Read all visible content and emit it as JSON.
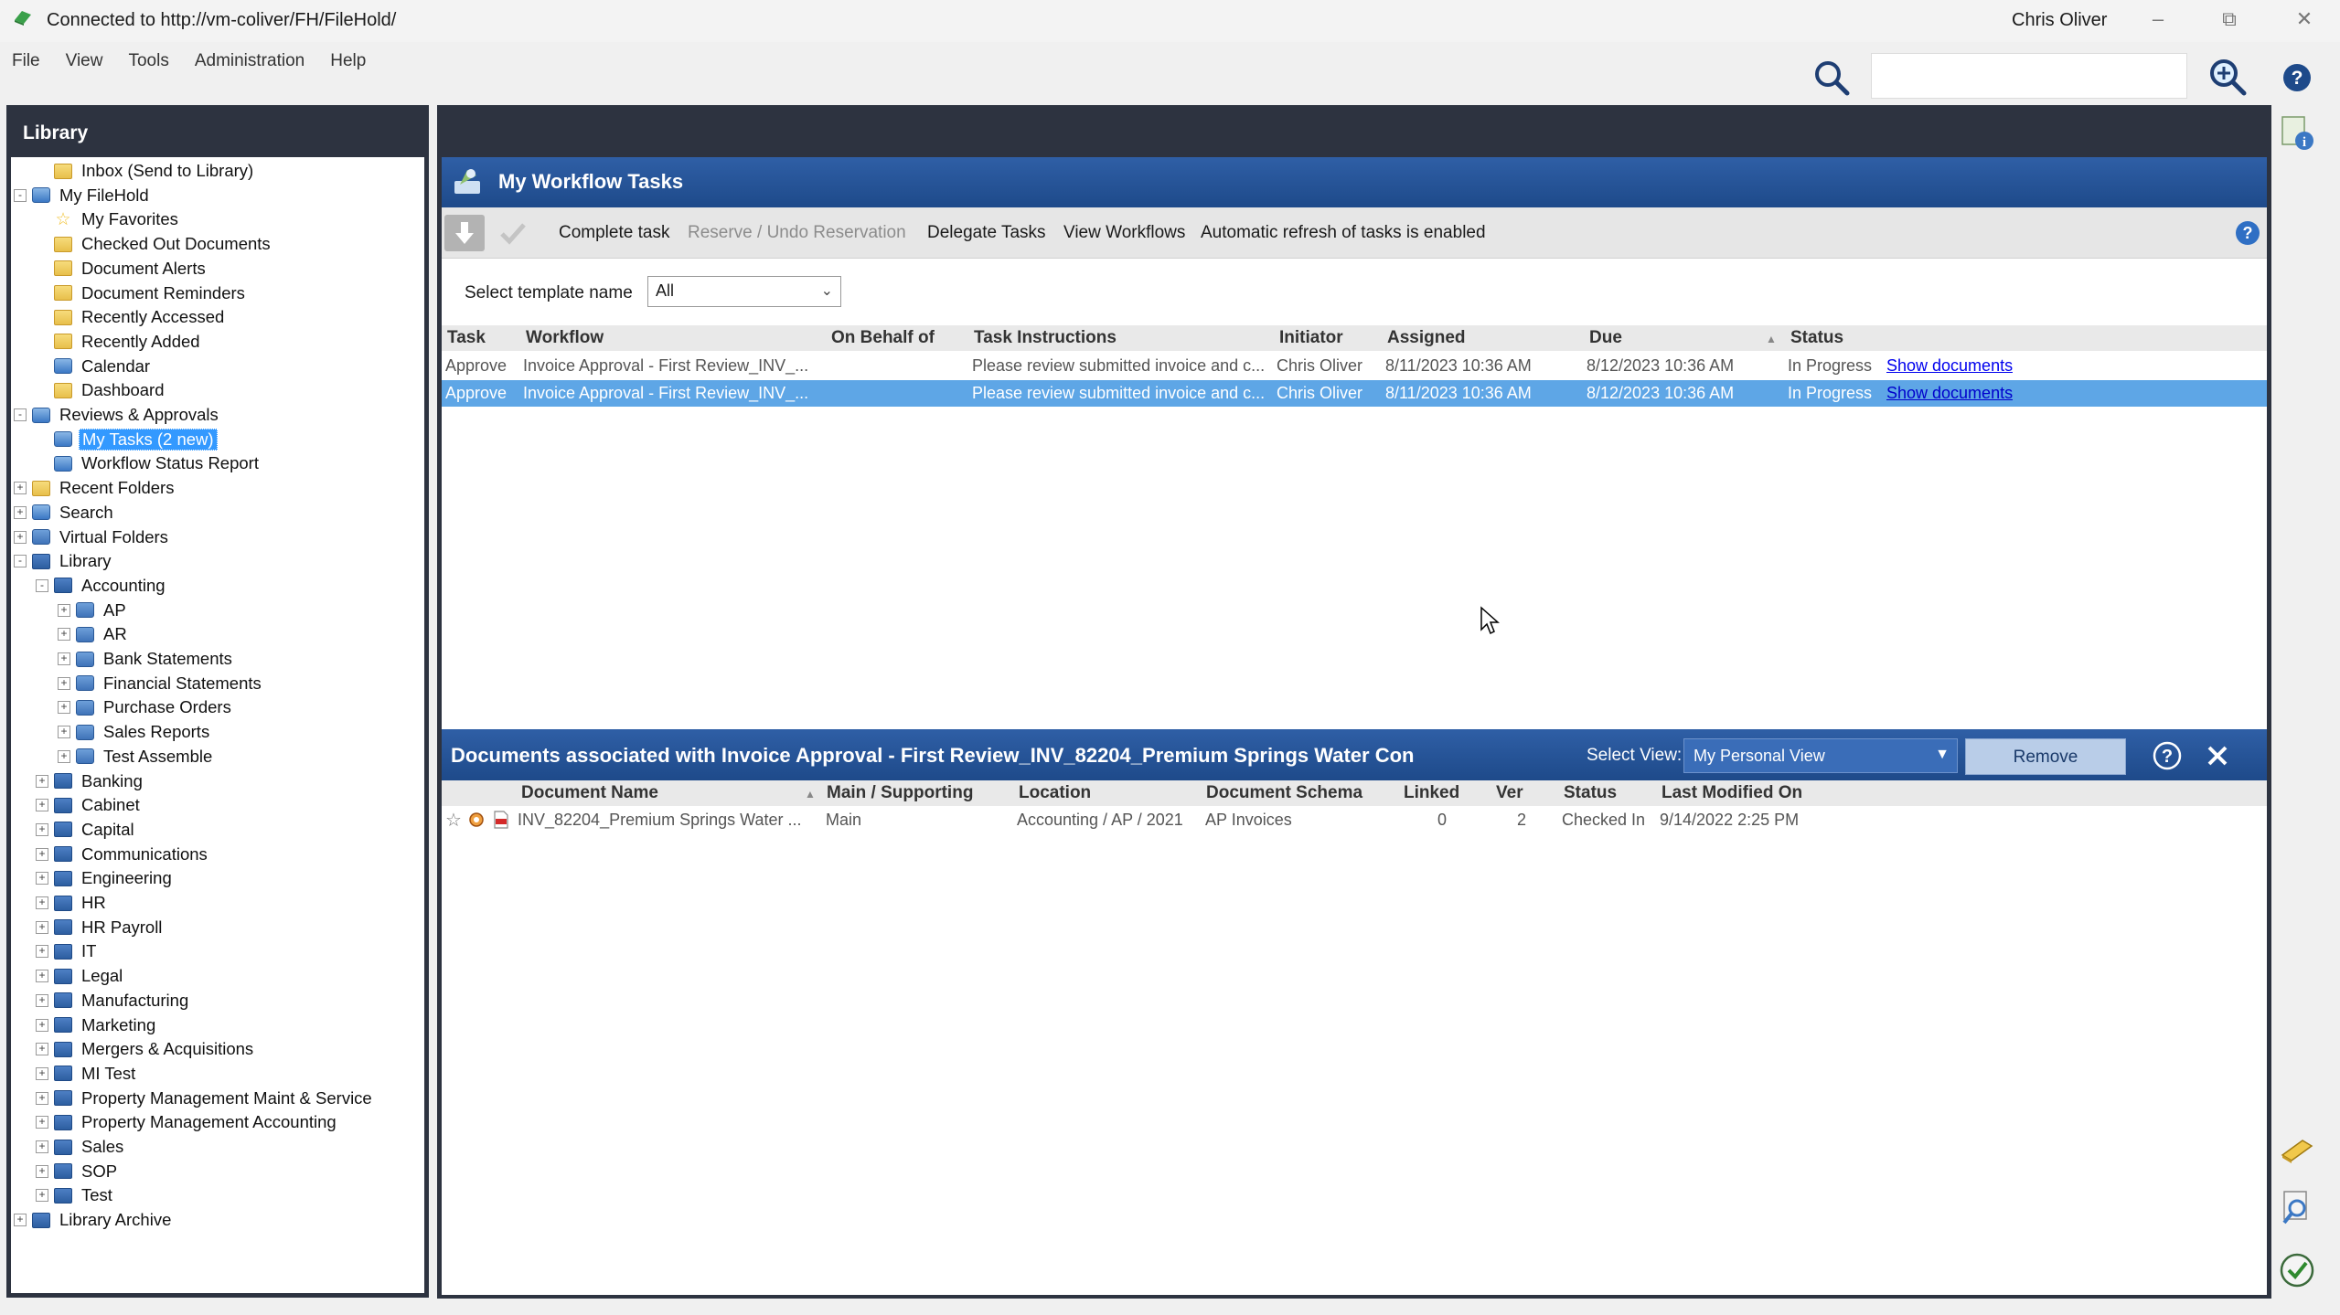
{
  "window": {
    "title": "Connected to http://vm-coliver/FH/FileHold/",
    "user": "Chris Oliver"
  },
  "menu": [
    "File",
    "View",
    "Tools",
    "Administration",
    "Help"
  ],
  "search": {
    "value": ""
  },
  "sidebar": {
    "title": "Library",
    "items": [
      {
        "label": "Inbox (Send to Library)",
        "level": 1,
        "exp": "",
        "icon": "folder"
      },
      {
        "label": "My FileHold",
        "level": 0,
        "exp": "-",
        "icon": "special"
      },
      {
        "label": "My Favorites",
        "level": 1,
        "exp": "",
        "icon": "star"
      },
      {
        "label": "Checked Out Documents",
        "level": 1,
        "exp": "",
        "icon": "folder"
      },
      {
        "label": "Document Alerts",
        "level": 1,
        "exp": "",
        "icon": "folder"
      },
      {
        "label": "Document Reminders",
        "level": 1,
        "exp": "",
        "icon": "folder"
      },
      {
        "label": "Recently Accessed",
        "level": 1,
        "exp": "",
        "icon": "folder"
      },
      {
        "label": "Recently Added",
        "level": 1,
        "exp": "",
        "icon": "folder"
      },
      {
        "label": "Calendar",
        "level": 1,
        "exp": "",
        "icon": "special"
      },
      {
        "label": "Dashboard",
        "level": 1,
        "exp": "",
        "icon": "folder"
      },
      {
        "label": "Reviews & Approvals",
        "level": 0,
        "exp": "-",
        "icon": "special"
      },
      {
        "label": "My Tasks (2 new)",
        "level": 1,
        "exp": "",
        "icon": "special",
        "selected": true
      },
      {
        "label": "Workflow Status Report",
        "level": 1,
        "exp": "",
        "icon": "special"
      },
      {
        "label": "Recent Folders",
        "level": 0,
        "exp": "+",
        "icon": "folder"
      },
      {
        "label": "Search",
        "level": 0,
        "exp": "+",
        "icon": "special"
      },
      {
        "label": "Virtual Folders",
        "level": 0,
        "exp": "+",
        "icon": "drawer"
      },
      {
        "label": "Library",
        "level": 0,
        "exp": "-",
        "icon": "cabinet"
      },
      {
        "label": "Accounting",
        "level": 1,
        "exp": "-",
        "icon": "cabinet"
      },
      {
        "label": "AP",
        "level": 2,
        "exp": "+",
        "icon": "drawer"
      },
      {
        "label": "AR",
        "level": 2,
        "exp": "+",
        "icon": "drawer"
      },
      {
        "label": "Bank Statements",
        "level": 2,
        "exp": "+",
        "icon": "drawer"
      },
      {
        "label": "Financial Statements",
        "level": 2,
        "exp": "+",
        "icon": "drawer"
      },
      {
        "label": "Purchase Orders",
        "level": 2,
        "exp": "+",
        "icon": "drawer"
      },
      {
        "label": "Sales Reports",
        "level": 2,
        "exp": "+",
        "icon": "drawer"
      },
      {
        "label": "Test Assemble",
        "level": 2,
        "exp": "+",
        "icon": "drawer"
      },
      {
        "label": "Banking",
        "level": 1,
        "exp": "+",
        "icon": "cabinet"
      },
      {
        "label": "Cabinet",
        "level": 1,
        "exp": "+",
        "icon": "cabinet"
      },
      {
        "label": "Capital",
        "level": 1,
        "exp": "+",
        "icon": "cabinet"
      },
      {
        "label": "Communications",
        "level": 1,
        "exp": "+",
        "icon": "cabinet"
      },
      {
        "label": "Engineering",
        "level": 1,
        "exp": "+",
        "icon": "cabinet"
      },
      {
        "label": "HR",
        "level": 1,
        "exp": "+",
        "icon": "cabinet"
      },
      {
        "label": "HR Payroll",
        "level": 1,
        "exp": "+",
        "icon": "cabinet"
      },
      {
        "label": "IT",
        "level": 1,
        "exp": "+",
        "icon": "cabinet"
      },
      {
        "label": "Legal",
        "level": 1,
        "exp": "+",
        "icon": "cabinet"
      },
      {
        "label": "Manufacturing",
        "level": 1,
        "exp": "+",
        "icon": "cabinet"
      },
      {
        "label": "Marketing",
        "level": 1,
        "exp": "+",
        "icon": "cabinet"
      },
      {
        "label": "Mergers & Acquisitions",
        "level": 1,
        "exp": "+",
        "icon": "cabinet"
      },
      {
        "label": "MI Test",
        "level": 1,
        "exp": "+",
        "icon": "cabinet"
      },
      {
        "label": "Property Management  Maint & Service",
        "level": 1,
        "exp": "+",
        "icon": "cabinet"
      },
      {
        "label": "Property Management Accounting",
        "level": 1,
        "exp": "+",
        "icon": "cabinet"
      },
      {
        "label": "Sales",
        "level": 1,
        "exp": "+",
        "icon": "cabinet"
      },
      {
        "label": "SOP",
        "level": 1,
        "exp": "+",
        "icon": "cabinet"
      },
      {
        "label": "Test",
        "level": 1,
        "exp": "+",
        "icon": "cabinet"
      },
      {
        "label": "Library Archive",
        "level": 0,
        "exp": "+",
        "icon": "cabinet"
      }
    ]
  },
  "workflow": {
    "title": "My Workflow Tasks",
    "toolbar": {
      "complete": "Complete task",
      "reserve": "Reserve / Undo Reservation",
      "delegate": "Delegate Tasks",
      "view": "View Workflows",
      "refresh": "Automatic refresh of tasks is enabled"
    },
    "template_label": "Select template name",
    "template_value": "All",
    "columns": [
      "Task",
      "Workflow",
      "On Behalf of",
      "Task Instructions",
      "Initiator",
      "Assigned",
      "Due",
      "Status"
    ],
    "rows": [
      {
        "task": "Approve",
        "workflow": "Invoice Approval - First Review_INV_...",
        "behalf": "",
        "instructions": "Please review submitted invoice and c...",
        "initiator": "Chris Oliver",
        "assigned": "8/11/2023 10:36 AM",
        "due": "8/12/2023 10:36 AM",
        "status": "In Progress",
        "link": "Show documents"
      },
      {
        "task": "Approve",
        "workflow": "Invoice Approval - First Review_INV_...",
        "behalf": "",
        "instructions": "Please review submitted invoice and c...",
        "initiator": "Chris Oliver",
        "assigned": "8/11/2023 10:36 AM",
        "due": "8/12/2023 10:36 AM",
        "status": "In Progress",
        "link": "Show documents"
      }
    ]
  },
  "documents": {
    "title": "Documents associated with Invoice Approval - First Review_INV_82204_Premium Springs Water Con",
    "select_view_label": "Select View:",
    "select_view_value": "My Personal View",
    "remove_label": "Remove",
    "columns": [
      "Document Name",
      "Main / Supporting",
      "Location",
      "Document Schema",
      "Linked",
      "Ver",
      "Status",
      "Last Modified On"
    ],
    "rows": [
      {
        "name": "INV_82204_Premium Springs Water ...",
        "main": "Main",
        "location": "Accounting / AP / 2021",
        "schema": "AP Invoices",
        "linked": "0",
        "ver": "2",
        "status": "Checked In",
        "modified": "9/14/2022 2:25 PM"
      }
    ]
  },
  "colors": {
    "header_blue": "#2f5fa6",
    "panel_dark": "#2d3340",
    "selection": "#5ea6e6",
    "tree_selected": "#3399ff",
    "link": "#0000ee"
  }
}
